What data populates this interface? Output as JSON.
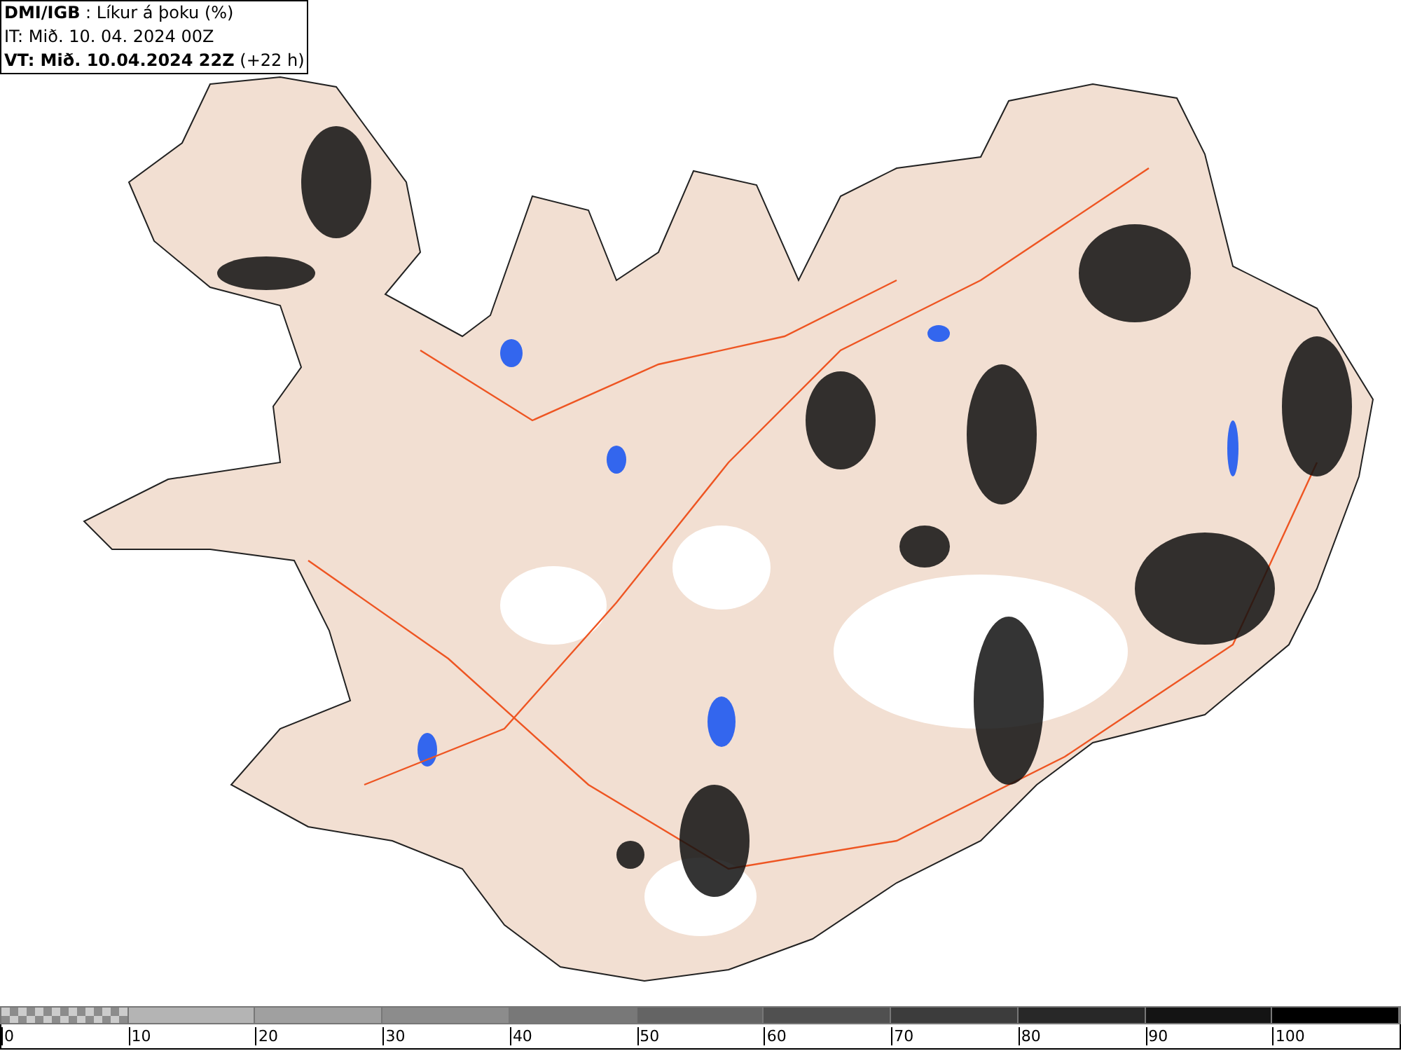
{
  "header": {
    "lines": [
      "**DMI/IGB** : Líkur á þoku (%)",
      "IT: Mið. 10. 04. 2024 00Z",
      "**VT: Mið. 10.04.2024 22Z** (+22 h)"
    ]
  },
  "legend": {
    "segments": [
      {
        "kind": "checker",
        "color": "#8c8c8c"
      },
      {
        "kind": "solid",
        "color": "#b4b4b4"
      },
      {
        "kind": "solid",
        "color": "#a0a0a0"
      },
      {
        "kind": "solid",
        "color": "#8c8c8c"
      },
      {
        "kind": "solid",
        "color": "#787878"
      },
      {
        "kind": "solid",
        "color": "#646464"
      },
      {
        "kind": "solid",
        "color": "#505050"
      },
      {
        "kind": "solid",
        "color": "#3c3c3c"
      },
      {
        "kind": "solid",
        "color": "#282828"
      },
      {
        "kind": "solid",
        "color": "#141414"
      },
      {
        "kind": "solid",
        "color": "#000000"
      }
    ],
    "ticks": [
      "0",
      "10",
      "20",
      "30",
      "40",
      "50",
      "60",
      "70",
      "80",
      "90",
      "100"
    ]
  }
}
